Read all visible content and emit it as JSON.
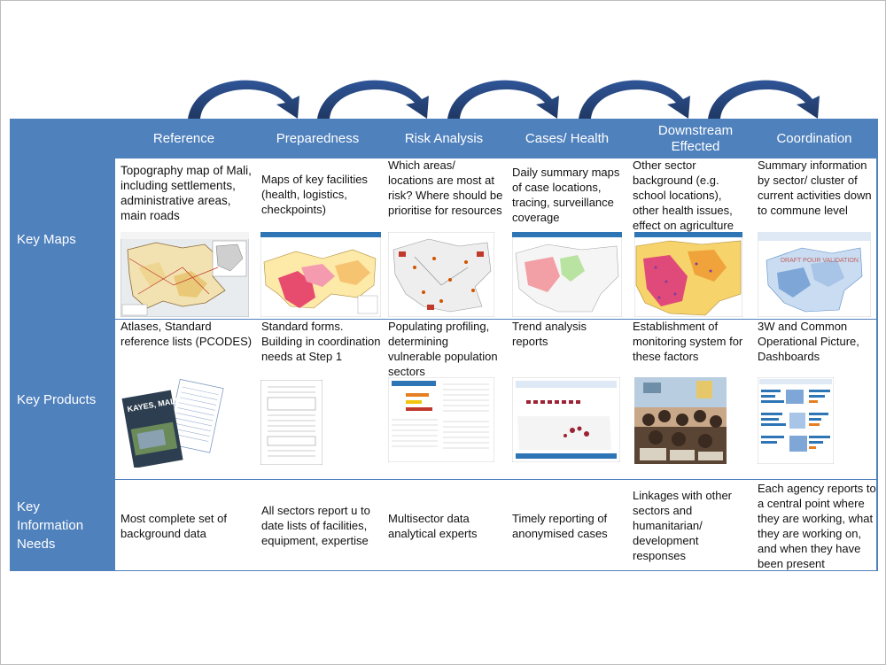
{
  "columns": [
    {
      "label": "Reference"
    },
    {
      "label": "Preparedness"
    },
    {
      "label": "Risk Analysis"
    },
    {
      "label": "Cases/ Health"
    },
    {
      "label": "Downstream Effected"
    },
    {
      "label": "Coordination"
    }
  ],
  "rows": [
    {
      "label": "Key Maps"
    },
    {
      "label": "Key Products"
    },
    {
      "label": "Key Information Needs"
    }
  ],
  "cells": {
    "maps": [
      "Topography map of Mali, including settlements, administrative areas, main roads",
      "Maps of key facilities (health, logistics, checkpoints)",
      "Which areas/ locations are most at risk? Where should be prioritise for resources",
      "Daily summary maps of case locations, tracing, surveillance coverage",
      "Other sector background (e.g. school locations), other health issues, effect on agriculture",
      "Summary information by sector/ cluster of current activities down to commune level"
    ],
    "products": [
      "Atlases, Standard reference lists (PCODES)",
      "Standard forms. Building in coordination needs at Step 1",
      "Populating profiling, determining vulnerable population sectors",
      "Trend analysis reports",
      "Establishment of monitoring system for these factors",
      "3W and Common Operational Picture, Dashboards"
    ],
    "needs": [
      "Most complete set of background data",
      "All sectors report u to date lists of facilities, equipment, expertise",
      "Multisector data analytical experts",
      "Timely reporting of anonymised cases",
      "Linkages with other sectors and humanitarian/ development responses",
      "Each agency reports to a central point where they are working, what they are working on, and when they have been present"
    ]
  },
  "thumbs": {
    "kayes_title": "KAYES, MALI",
    "draft_watermark": "DRAFT POUR VALIDATION"
  },
  "colors": {
    "band": "#4f81bd",
    "arrow": "#1f3864"
  }
}
